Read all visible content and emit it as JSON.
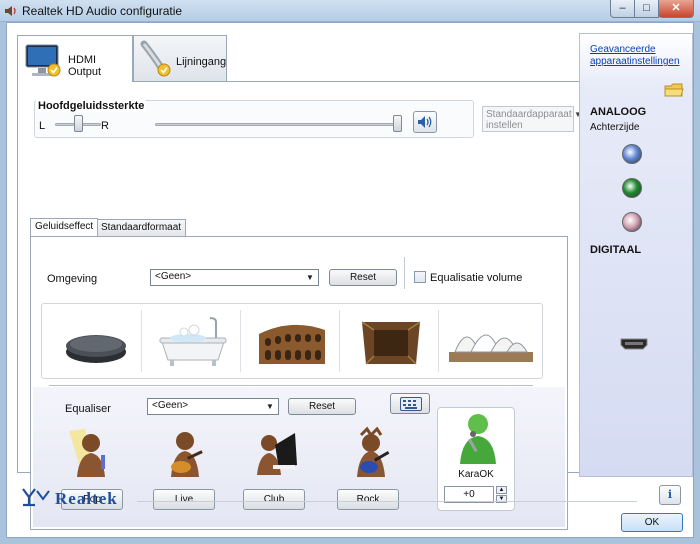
{
  "window": {
    "title": "Realtek HD Audio configuratie",
    "min_glyph": "–",
    "max_glyph": "□",
    "close_glyph": "✕"
  },
  "device_tabs": [
    {
      "label": "HDMI Output",
      "active": true
    },
    {
      "label": "Lijningang",
      "active": false
    }
  ],
  "volume": {
    "title": "Hoofdgeluidssterkte",
    "left_label": "L",
    "right_label": "R",
    "balance": 0.5,
    "level": 1.0,
    "default_device_label": "Standaardapparaat instellen"
  },
  "inner_tabs": [
    {
      "label": "Geluidseffect",
      "active": true
    },
    {
      "label": "Standaardformaat",
      "active": false
    }
  ],
  "environment": {
    "label": "Omgeving",
    "value": "<Geen>",
    "reset_label": "Reset",
    "equalize_label": "Equalisatie volume",
    "equalize_checked": false,
    "presets": [
      "stone-disc",
      "bathtub",
      "colosseum",
      "wooden-room",
      "opera-house"
    ]
  },
  "equalizer": {
    "label": "Equaliser",
    "value": "<Geen>",
    "reset_label": "Reset",
    "presets": [
      {
        "label": "Pop"
      },
      {
        "label": "Live"
      },
      {
        "label": "Club"
      },
      {
        "label": "Rock"
      }
    ],
    "karaoke_label": "KaraOK",
    "karaoke_value": "+0"
  },
  "right_pane": {
    "advanced_link": "Geavanceerde apparaatinstellingen",
    "analog_title": "ANALOOG",
    "analog_sub": "Achterzijde",
    "digital_title": "DIGITAAL",
    "jack_colors": [
      "#5f86d6",
      "#1d8a2b",
      "#d3a4b4"
    ]
  },
  "footer": {
    "brand": "Realtek",
    "ok_label": "OK",
    "info_glyph": "i"
  }
}
